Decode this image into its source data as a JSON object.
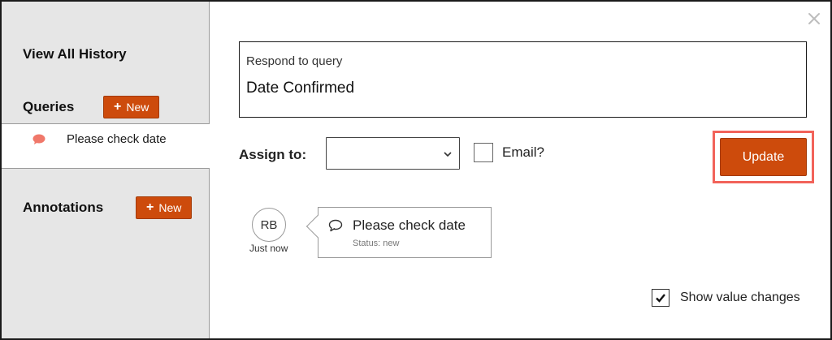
{
  "sidebar": {
    "view_all_label": "View All History",
    "queries": {
      "title": "Queries",
      "new_label": "New"
    },
    "query_items": [
      {
        "label": "Please check date",
        "icon": "speech-bubble-icon"
      }
    ],
    "annotations": {
      "title": "Annotations",
      "new_label": "New"
    }
  },
  "main": {
    "close_icon": "close-icon",
    "respond": {
      "label": "Respond to query",
      "value": "Date Confirmed"
    },
    "assign": {
      "label": "Assign to:",
      "selected": ""
    },
    "email": {
      "label": "Email?",
      "checked": false
    },
    "update_label": "Update",
    "history": {
      "avatar_initials": "RB",
      "time": "Just now",
      "title": "Please check date",
      "status": "Status: new"
    },
    "show_value_changes": {
      "label": "Show value changes",
      "checked": true
    }
  },
  "colors": {
    "accent": "#cd4b0c",
    "highlight": "#f2635a",
    "sidebar_bg": "#e6e6e6",
    "bubble": "#f0786a"
  }
}
